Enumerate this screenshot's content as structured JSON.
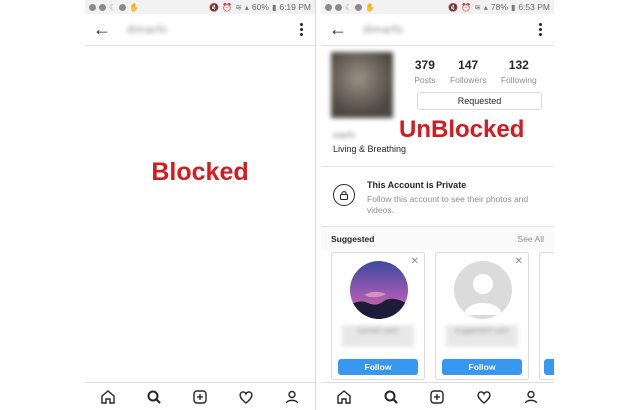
{
  "left": {
    "status": {
      "battery": "60%",
      "time": "6:19 PM"
    },
    "header": {
      "username": "dimarfo"
    },
    "overlay_label": "Blocked"
  },
  "right": {
    "status": {
      "battery": "78%",
      "time": "6:53 PM"
    },
    "header": {
      "username": "dimarfo"
    },
    "stats": [
      {
        "value": "379",
        "label": "Posts"
      },
      {
        "value": "147",
        "label": "Followers"
      },
      {
        "value": "132",
        "label": "Following"
      }
    ],
    "requested_label": "Requested",
    "display_name": "warfo",
    "bio": "Living & Breathing",
    "overlay_label": "UnBlocked",
    "private": {
      "title": "This Account is Private",
      "description": "Follow this account to see their photos and videos."
    },
    "suggested": {
      "title": "Suggested",
      "see_all": "See All",
      "cards": [
        {
          "name": "sunset user",
          "follow": "Follow"
        },
        {
          "name": "suggested user",
          "follow": "Follow"
        }
      ]
    }
  },
  "icons": [
    "back-arrow-icon",
    "more-vertical-icon",
    "home-icon",
    "search-icon",
    "add-post-icon",
    "heart-icon",
    "profile-icon",
    "lock-icon",
    "close-icon"
  ],
  "colors": {
    "label_red": "#d71920",
    "follow_blue": "#3897f0"
  }
}
